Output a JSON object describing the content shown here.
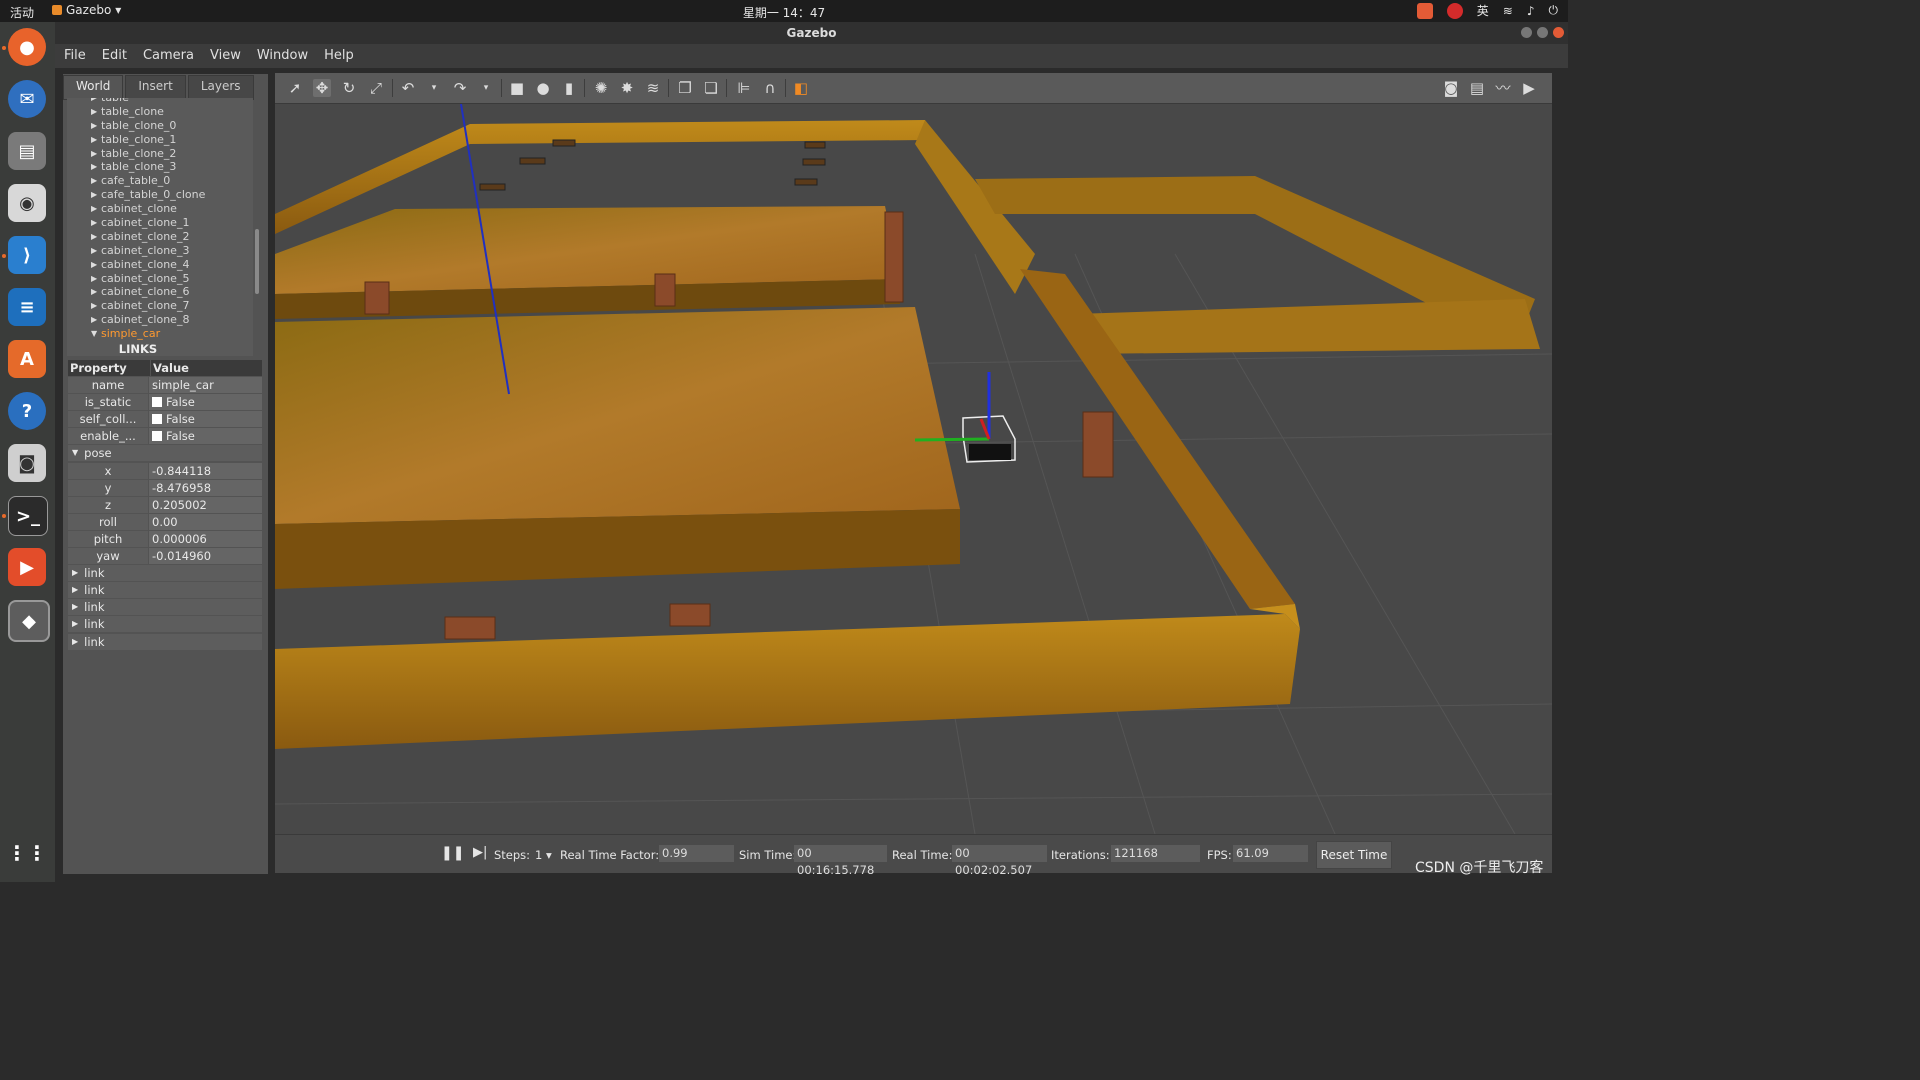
{
  "topbar": {
    "activities": "活动",
    "app_name": "Gazebo",
    "clock": "星期一 14：47",
    "input_method": "英"
  },
  "window": {
    "title": "Gazebo"
  },
  "menu": [
    "File",
    "Edit",
    "Camera",
    "View",
    "Window",
    "Help"
  ],
  "left_panel": {
    "tabs": [
      "World",
      "Insert",
      "Layers"
    ],
    "active_tab": "World",
    "tree_items": [
      "table",
      "table_clone",
      "table_clone_0",
      "table_clone_1",
      "table_clone_2",
      "table_clone_3",
      "cafe_table_0",
      "cafe_table_0_clone",
      "cabinet_clone",
      "cabinet_clone_1",
      "cabinet_clone_2",
      "cabinet_clone_3",
      "cabinet_clone_4",
      "cabinet_clone_5",
      "cabinet_clone_6",
      "cabinet_clone_7",
      "cabinet_clone_8"
    ],
    "selected_item": "simple_car",
    "links_header": "LINKS",
    "property_header": "Property",
    "value_header": "Value",
    "properties": [
      {
        "key": "name",
        "value": "simple_car",
        "checkbox": false
      },
      {
        "key": "is_static",
        "value": "False",
        "checkbox": true
      },
      {
        "key": "self_coll...",
        "value": "False",
        "checkbox": true
      },
      {
        "key": "enable_...",
        "value": "False",
        "checkbox": true
      }
    ],
    "pose_label": "pose",
    "pose": [
      {
        "key": "x",
        "value": "-0.844118"
      },
      {
        "key": "y",
        "value": "-8.476958"
      },
      {
        "key": "z",
        "value": "0.205002"
      },
      {
        "key": "roll",
        "value": "0.00"
      },
      {
        "key": "pitch",
        "value": "0.000006"
      },
      {
        "key": "yaw",
        "value": "-0.014960"
      }
    ],
    "links": [
      "link",
      "link",
      "link",
      "link",
      "link"
    ]
  },
  "bottom_bar": {
    "steps_label": "Steps:",
    "steps_value": "1",
    "rtf_label": "Real Time Factor:",
    "rtf_value": "0.99",
    "sim_label": "Sim Time:",
    "sim_value": "00 00:16:15.778",
    "real_label": "Real Time:",
    "real_value": "00 00:02:02.507",
    "iter_label": "Iterations:",
    "iter_value": "121168",
    "fps_label": "FPS:",
    "fps_value": "61.09",
    "reset_label": "Reset Time"
  },
  "watermark": "CSDN @千里飞刀客",
  "colors": {
    "wood": "#b07a1a",
    "accent": "#ff9a30",
    "floor": "#4a4a4a"
  }
}
